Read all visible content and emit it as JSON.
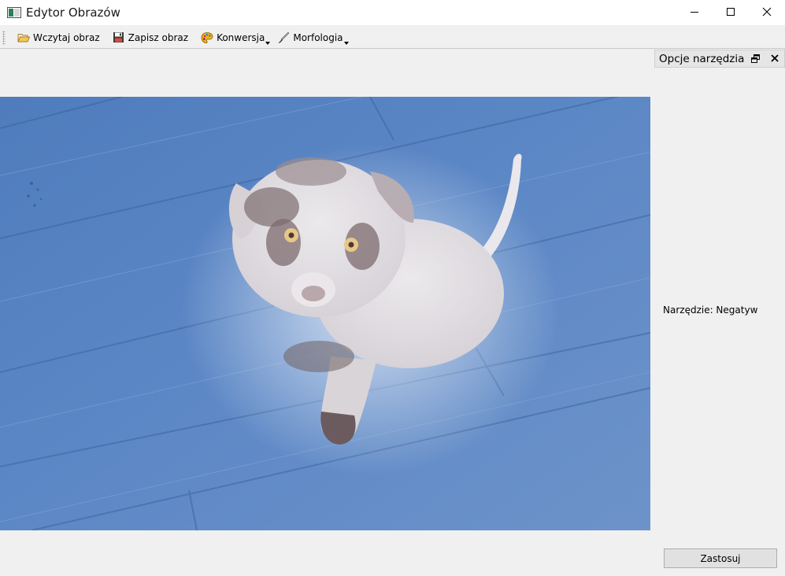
{
  "window": {
    "title": "Edytor Obrazów",
    "controls": [
      "minimize-icon",
      "maximize-icon",
      "close-icon"
    ]
  },
  "toolbar": {
    "items": [
      {
        "label": "Wczytaj obraz",
        "icon": "folder-open-icon",
        "has_menu": false
      },
      {
        "label": "Zapisz obraz",
        "icon": "save-icon",
        "has_menu": false
      },
      {
        "label": "Konwersja",
        "icon": "palette-icon",
        "has_menu": true
      },
      {
        "label": "Morfologia",
        "icon": "brush-icon",
        "has_menu": true
      }
    ]
  },
  "image": {
    "description_icon": "inverted-puppy-photo",
    "colors": {
      "floor": "#5a85c2",
      "floor_dark": "#3f6aa8",
      "dog": "#e2e0e4"
    }
  },
  "dock": {
    "title": "Opcje narzędzia",
    "tool_label": "Narzędzie: Negatyw",
    "apply_label": "Zastosuj"
  }
}
